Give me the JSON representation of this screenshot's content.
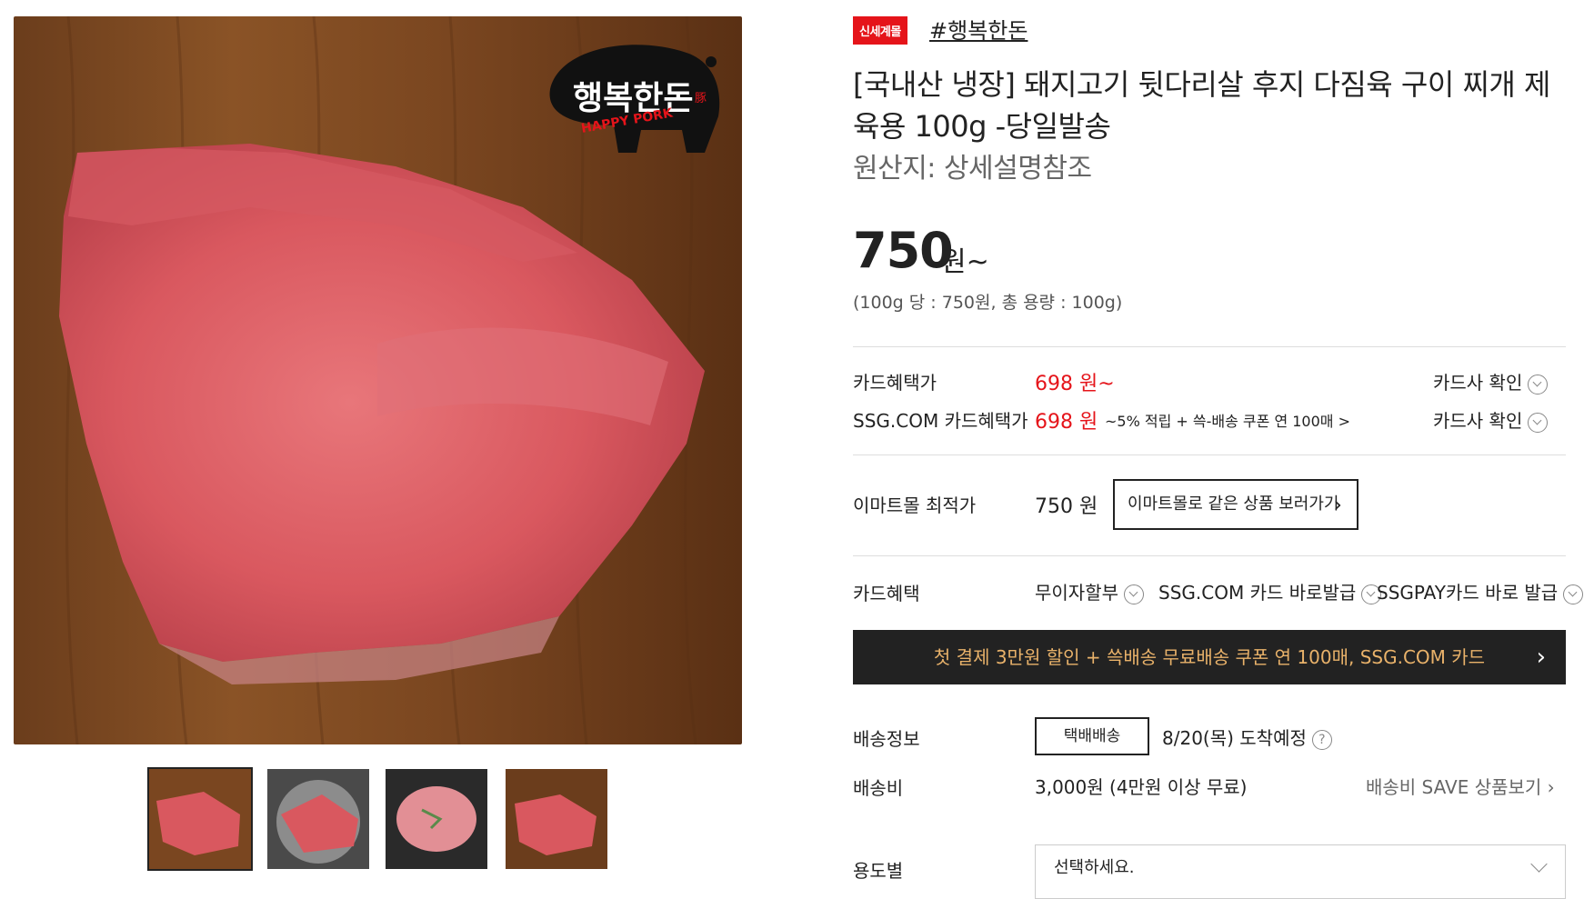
{
  "badge": "신세계몰",
  "brand_tag": "#행복한돈",
  "title": "[국내산 냉장] 돼지고기 뒷다리살 후지 다짐육 구이 찌개 제육용 100g -당일발송",
  "origin": "원산지: 상세설명참조",
  "price": "750",
  "price_unit": "원~",
  "unit_price": "(100g 당 : 750원, 총 용량 : 100g)",
  "logo": {
    "text_ko": "행복한돈",
    "text_en": "HAPPY PORK",
    "seal": "豚"
  },
  "card": {
    "label1": "카드혜택가",
    "price1": "698 원~",
    "check1": "카드사 확인",
    "label2": "SSG.COM 카드혜택가",
    "price2": "698 원",
    "promo2": "~5% 적립 + 쓱-배송 쿠폰 연 100매 >",
    "check2": "카드사 확인"
  },
  "emart": {
    "label": "이마트몰 최적가",
    "price": "750 원",
    "button": "이마트몰로 같은 상품 보러가기"
  },
  "benefits": {
    "label": "카드혜택",
    "items": [
      "무이자할부",
      "SSG.COM 카드 바로발급",
      "SSGPAY카드 바로 발급"
    ]
  },
  "banner": "첫 결제 3만원 할인 + 쓱배송 무료배송 쿠폰 연 100매, SSG.COM 카드",
  "delivery": {
    "label": "배송정보",
    "button": "택배배송",
    "arrival": "8/20(목) 도착예정"
  },
  "shipping": {
    "label": "배송비",
    "value": "3,000원 (4만원 이상 무료)",
    "link": "배송비 SAVE 상품보기"
  },
  "option": {
    "label": "용도별",
    "placeholder": "선택하세요."
  },
  "colors": {
    "accent": "#e5141a",
    "banner_bg": "#222222",
    "banner_text": "#e9b26a"
  }
}
